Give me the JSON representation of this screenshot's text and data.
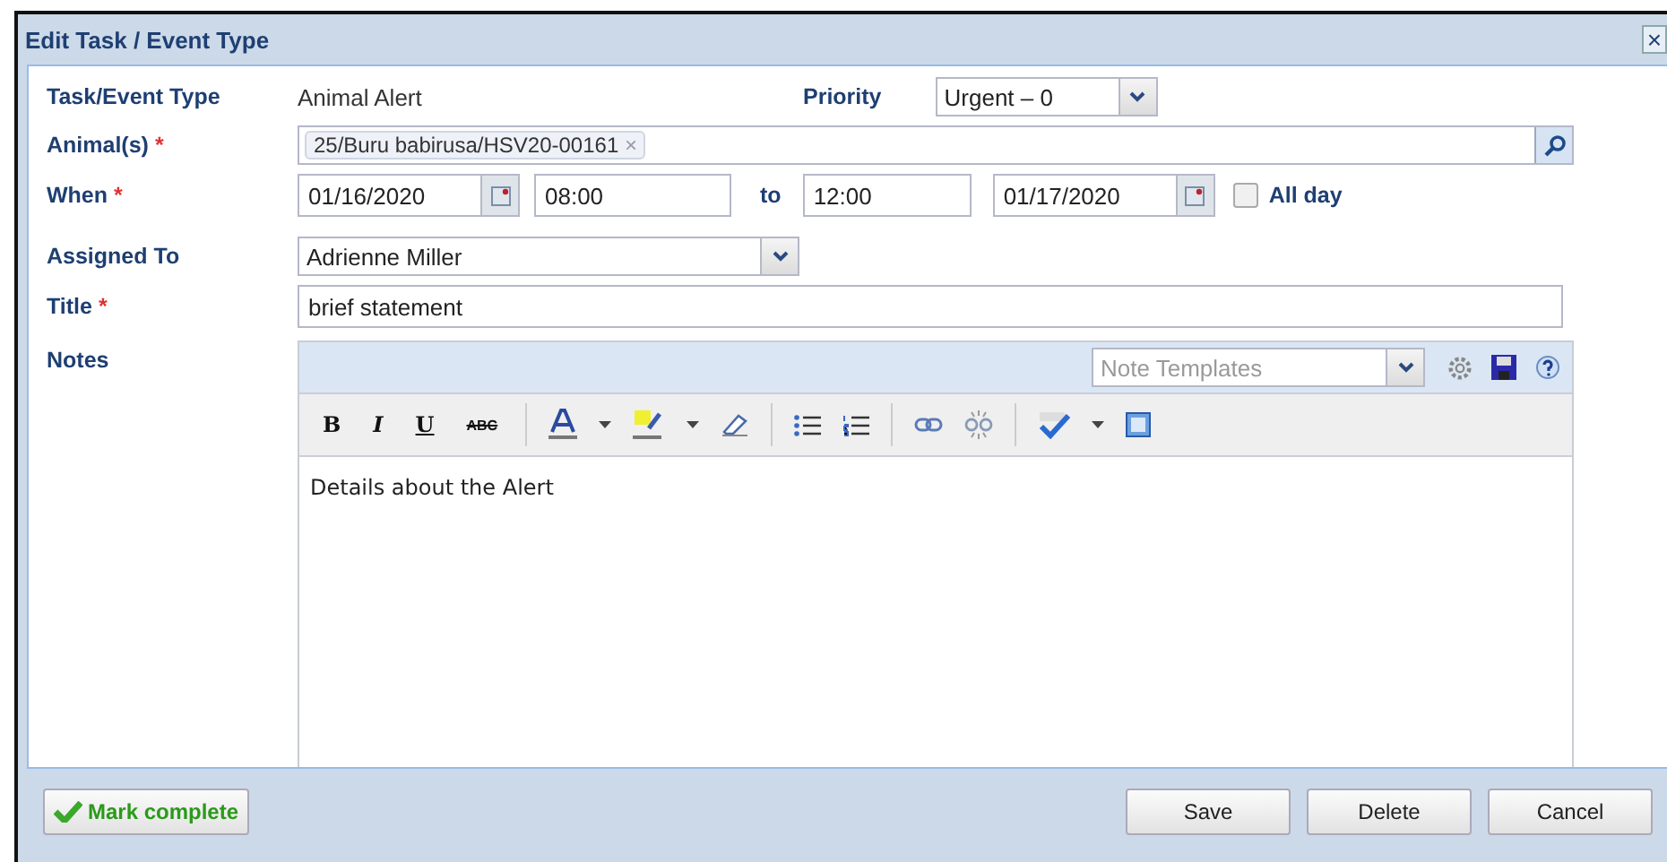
{
  "window": {
    "title": "Edit Task / Event Type",
    "close": "×"
  },
  "form": {
    "type_label": "Task/Event Type",
    "type_value": "Animal Alert",
    "priority_label": "Priority",
    "priority_value": "Urgent – 0",
    "animals_label": "Animal(s)",
    "animals": [
      "25/Buru babirusa/HSV20-00161"
    ],
    "tag_remove": "×",
    "when_label": "When",
    "start_date": "01/16/2020",
    "start_time": "08:00",
    "to_label": "to",
    "end_time": "12:00",
    "end_date": "01/17/2020",
    "all_day": {
      "label": "All day",
      "checked": false
    },
    "assigned_label": "Assigned To",
    "assigned_value": "Adrienne Miller",
    "title_label": "Title",
    "title_value": "brief statement",
    "required_mark": "*",
    "notes_label": "Notes"
  },
  "editor": {
    "templates_placeholder": "Note Templates",
    "format_buttons": [
      "B",
      "I",
      "U",
      "ABC"
    ],
    "content": "Details about the Alert"
  },
  "footer": {
    "mark_complete": "Mark complete",
    "buttons": [
      "Save",
      "Delete",
      "Cancel"
    ]
  }
}
